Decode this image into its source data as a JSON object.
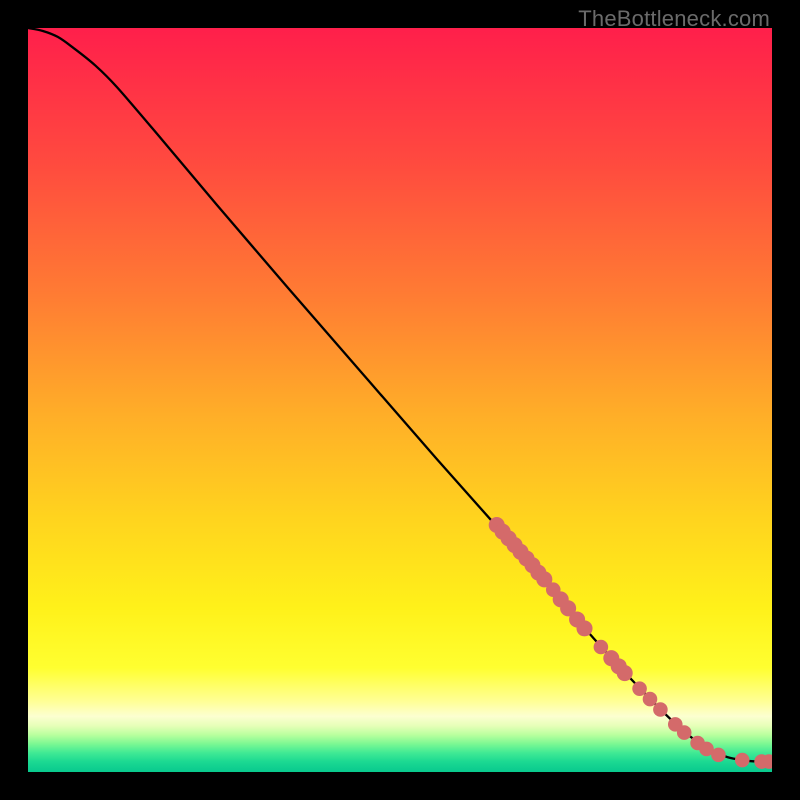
{
  "watermark": "TheBottleneck.com",
  "chart_data": {
    "type": "line",
    "title": "",
    "xlabel": "",
    "ylabel": "",
    "xlim": [
      0,
      100
    ],
    "ylim": [
      0,
      100
    ],
    "curve": {
      "name": "main-curve",
      "x": [
        0.0,
        2.0,
        4.0,
        6.0,
        9.0,
        12.0,
        18.0,
        26.0,
        35.0,
        45.0,
        55.0,
        63.0,
        70.0,
        76.0,
        82.0,
        87.0,
        90.0,
        92.0,
        94.0,
        96.0,
        98.0,
        100.0
      ],
      "y": [
        100.0,
        99.6,
        98.8,
        97.4,
        95.0,
        92.0,
        85.0,
        75.5,
        65.0,
        53.5,
        42.0,
        33.0,
        25.0,
        18.0,
        11.5,
        6.5,
        4.0,
        2.8,
        2.0,
        1.6,
        1.4,
        1.4
      ]
    },
    "markers": {
      "name": "scatter-points",
      "color": "#d46a6a",
      "points": [
        {
          "x": 63.0,
          "y": 33.2,
          "r": 1.1
        },
        {
          "x": 63.8,
          "y": 32.3,
          "r": 1.1
        },
        {
          "x": 64.6,
          "y": 31.4,
          "r": 1.1
        },
        {
          "x": 65.4,
          "y": 30.5,
          "r": 1.1
        },
        {
          "x": 66.2,
          "y": 29.6,
          "r": 1.1
        },
        {
          "x": 67.0,
          "y": 28.7,
          "r": 1.1
        },
        {
          "x": 67.8,
          "y": 27.8,
          "r": 1.1
        },
        {
          "x": 68.6,
          "y": 26.8,
          "r": 1.1
        },
        {
          "x": 69.4,
          "y": 25.9,
          "r": 1.1
        },
        {
          "x": 70.6,
          "y": 24.5,
          "r": 1.0
        },
        {
          "x": 71.6,
          "y": 23.2,
          "r": 1.1
        },
        {
          "x": 72.6,
          "y": 22.0,
          "r": 1.1
        },
        {
          "x": 73.8,
          "y": 20.5,
          "r": 1.1
        },
        {
          "x": 74.8,
          "y": 19.3,
          "r": 1.1
        },
        {
          "x": 77.0,
          "y": 16.8,
          "r": 1.0
        },
        {
          "x": 78.4,
          "y": 15.3,
          "r": 1.1
        },
        {
          "x": 79.4,
          "y": 14.2,
          "r": 1.1
        },
        {
          "x": 80.2,
          "y": 13.3,
          "r": 1.1
        },
        {
          "x": 82.2,
          "y": 11.2,
          "r": 1.0
        },
        {
          "x": 83.6,
          "y": 9.8,
          "r": 1.0
        },
        {
          "x": 85.0,
          "y": 8.4,
          "r": 1.0
        },
        {
          "x": 87.0,
          "y": 6.4,
          "r": 1.0
        },
        {
          "x": 88.2,
          "y": 5.3,
          "r": 1.0
        },
        {
          "x": 90.0,
          "y": 3.9,
          "r": 1.0
        },
        {
          "x": 91.2,
          "y": 3.1,
          "r": 1.0
        },
        {
          "x": 92.8,
          "y": 2.3,
          "r": 1.0
        },
        {
          "x": 96.0,
          "y": 1.6,
          "r": 1.0
        },
        {
          "x": 98.6,
          "y": 1.4,
          "r": 1.0
        },
        {
          "x": 99.6,
          "y": 1.4,
          "r": 1.0
        }
      ]
    },
    "background_gradient": {
      "stops": [
        {
          "offset": 0.0,
          "color": "#ff1f4b"
        },
        {
          "offset": 0.18,
          "color": "#ff4a3f"
        },
        {
          "offset": 0.36,
          "color": "#ff7c33"
        },
        {
          "offset": 0.52,
          "color": "#ffae28"
        },
        {
          "offset": 0.66,
          "color": "#ffd41e"
        },
        {
          "offset": 0.78,
          "color": "#fff11a"
        },
        {
          "offset": 0.86,
          "color": "#ffff30"
        },
        {
          "offset": 0.905,
          "color": "#ffff96"
        },
        {
          "offset": 0.925,
          "color": "#fcffd0"
        },
        {
          "offset": 0.938,
          "color": "#e6ffb8"
        },
        {
          "offset": 0.95,
          "color": "#baff9e"
        },
        {
          "offset": 0.962,
          "color": "#7cf893"
        },
        {
          "offset": 0.974,
          "color": "#41ea94"
        },
        {
          "offset": 0.986,
          "color": "#1cd992"
        },
        {
          "offset": 1.0,
          "color": "#08c98e"
        }
      ]
    }
  }
}
